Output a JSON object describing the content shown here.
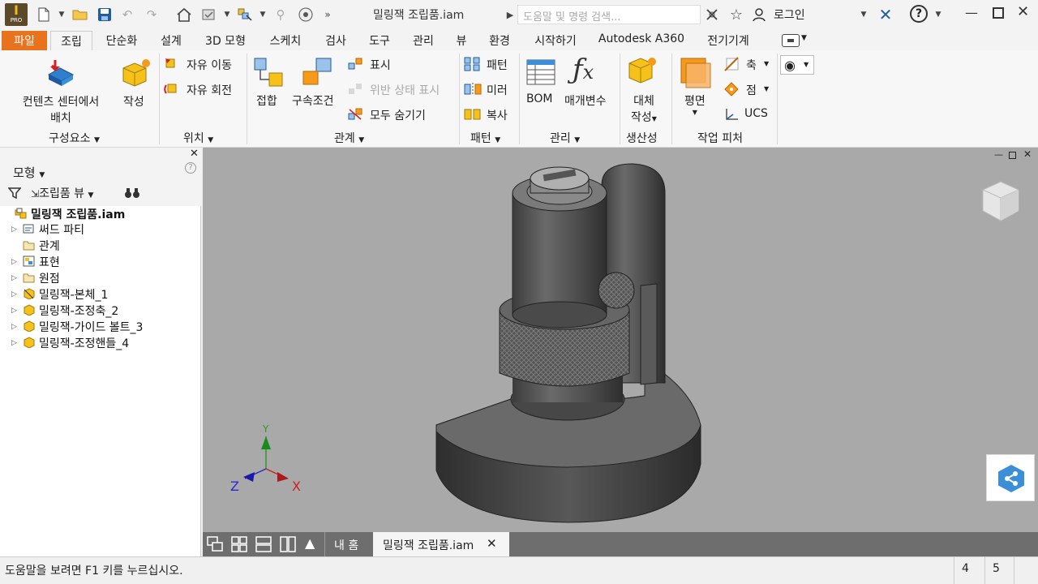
{
  "title_bar": {
    "logo_text": "I",
    "logo_sub": "PRO",
    "doc_title": "밀링잭 조립품.iam",
    "search_placeholder": "도움말 및 명령 검색...",
    "login": "로그인",
    "help": "?"
  },
  "tabs": [
    {
      "label": "파일"
    },
    {
      "label": "조립"
    },
    {
      "label": "단순화"
    },
    {
      "label": "설계"
    },
    {
      "label": "3D 모형"
    },
    {
      "label": "스케치"
    },
    {
      "label": "검사"
    },
    {
      "label": "도구"
    },
    {
      "label": "관리"
    },
    {
      "label": "뷰"
    },
    {
      "label": "환경"
    },
    {
      "label": "시작하기"
    },
    {
      "label": "Autodesk A360"
    },
    {
      "label": "전기기계"
    }
  ],
  "ribbon": {
    "component": {
      "place_line1": "컨텐츠 센터에서",
      "place_line2": "배치",
      "create": "작성",
      "panel": "구성요소"
    },
    "position": {
      "free_move": "자유 이동",
      "free_rotate": "자유 회전",
      "panel": "위치"
    },
    "relationships": {
      "constrain": "접합",
      "joint": "구속조건",
      "show": "표시",
      "show_sick": "위반 상태 표시",
      "hide_all": "모두 숨기기",
      "panel": "관계"
    },
    "pattern": {
      "pattern": "패턴",
      "mirror": "미러",
      "copy": "복사",
      "panel": "패턴"
    },
    "manage": {
      "bom": "BOM",
      "params": "매개변수",
      "panel": "관리"
    },
    "productivity": {
      "substitute_line1": "대체",
      "substitute_line2": "작성",
      "panel": "생산성"
    },
    "work_features": {
      "plane": "평면",
      "axis": "축",
      "point": "점",
      "ucs": "UCS",
      "panel": "작업 피처"
    }
  },
  "browser": {
    "title": "모형",
    "view": "조립품 뷰",
    "root": "밀링잭 조립품.iam",
    "items": [
      {
        "label": "써드 파티",
        "expand": true
      },
      {
        "label": "관계",
        "expand": false
      },
      {
        "label": "표현",
        "expand": true
      },
      {
        "label": "원점",
        "expand": true
      },
      {
        "label": "밀링잭-본체_1",
        "expand": true
      },
      {
        "label": "밀링잭-조정축_2",
        "expand": true
      },
      {
        "label": "밀링잭-가이드 볼트_3",
        "expand": true
      },
      {
        "label": "밀링잭-조정핸들_4",
        "expand": true
      }
    ]
  },
  "viewport": {
    "axis_x": "X",
    "axis_y": "Y",
    "axis_z": "Z"
  },
  "doc_tabs": {
    "home": "내 홈",
    "active": "밀링잭 조립품.iam"
  },
  "status": {
    "message": "도움말을 보려면 F1 키를 누르십시오.",
    "count1": "4",
    "count2": "5"
  },
  "colors": {
    "accent": "#e9721d",
    "viewport_bg": "#a9a9a9",
    "doc_tab_bar": "#6e6e6e",
    "share_button": "#3b8ed8"
  }
}
